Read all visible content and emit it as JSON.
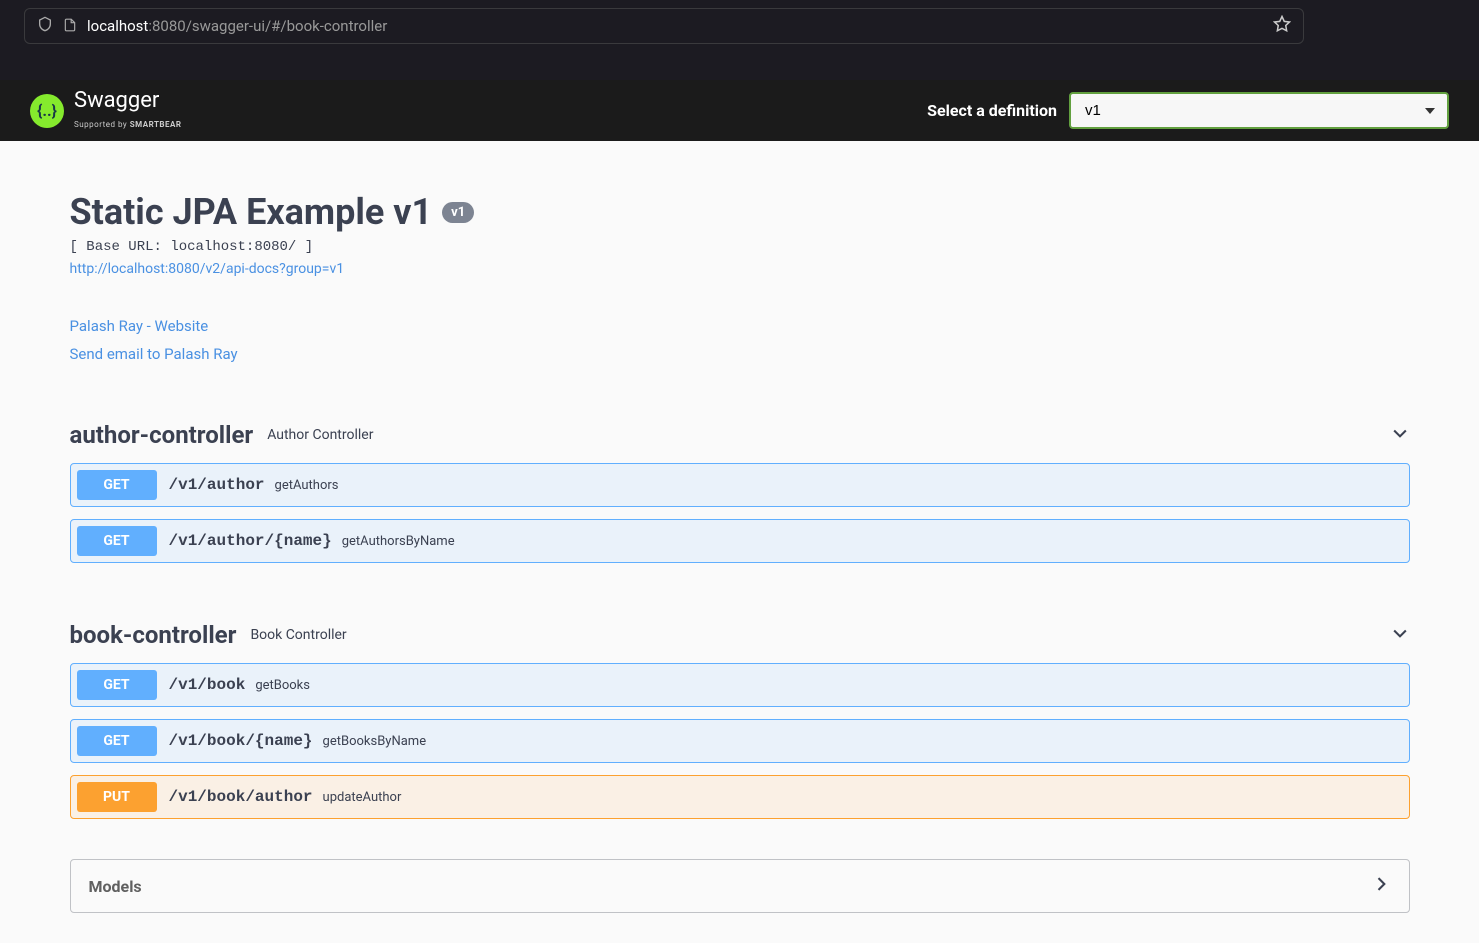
{
  "browser": {
    "url_host": "localhost",
    "url_port": ":8080",
    "url_path": "/swagger-ui/#/book-controller"
  },
  "header": {
    "brand": "Swagger",
    "supported_by_prefix": "Supported by ",
    "supported_by": "SMARTBEAR",
    "def_label": "Select a definition",
    "def_value": "v1"
  },
  "api": {
    "title": "Static JPA Example v1",
    "version": "v1",
    "base_url": "[ Base URL: localhost:8080/ ]",
    "docs_link": "http://localhost:8080/v2/api-docs?group=v1",
    "contact_website": "Palash Ray - Website",
    "contact_email": "Send email to Palash Ray"
  },
  "tags": [
    {
      "name": "author-controller",
      "desc": "Author Controller",
      "ops": [
        {
          "method": "GET",
          "method_class": "get",
          "path": "/v1/author",
          "summary": "getAuthors"
        },
        {
          "method": "GET",
          "method_class": "get",
          "path": "/v1/author/{name}",
          "summary": "getAuthorsByName"
        }
      ]
    },
    {
      "name": "book-controller",
      "desc": "Book Controller",
      "ops": [
        {
          "method": "GET",
          "method_class": "get",
          "path": "/v1/book",
          "summary": "getBooks"
        },
        {
          "method": "GET",
          "method_class": "get",
          "path": "/v1/book/{name}",
          "summary": "getBooksByName"
        },
        {
          "method": "PUT",
          "method_class": "put",
          "path": "/v1/book/author",
          "summary": "updateAuthor"
        }
      ]
    }
  ],
  "models": {
    "title": "Models"
  }
}
